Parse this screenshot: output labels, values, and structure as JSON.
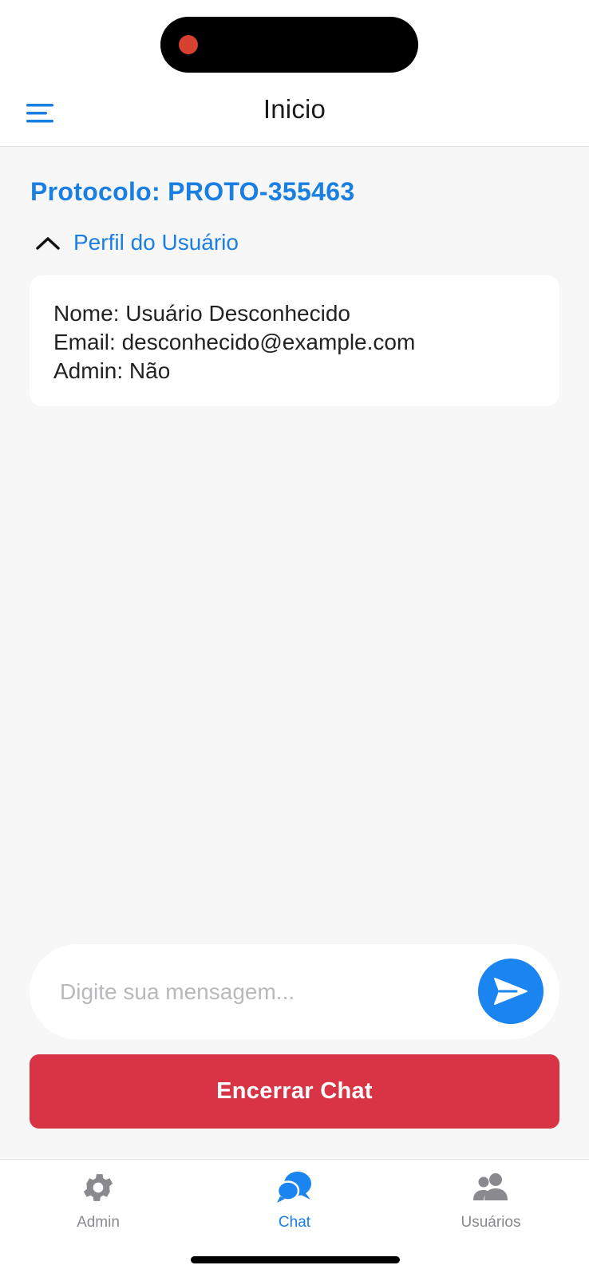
{
  "header": {
    "title": "Inicio",
    "menu_icon": "hamburger-menu-icon"
  },
  "protocol": {
    "text": "Protocolo: PROTO-355463"
  },
  "profile": {
    "toggle_label": "Perfil do Usuário",
    "toggle_icon": "chevron-up-icon",
    "name_line": "Nome: Usuário Desconhecido",
    "email_line": "Email: desconhecido@example.com",
    "admin_line": "Admin: Não"
  },
  "composer": {
    "placeholder": "Digite sua mensagem...",
    "value": "",
    "send_icon": "send-icon"
  },
  "actions": {
    "end_chat_label": "Encerrar Chat"
  },
  "tabs": [
    {
      "label": "Admin",
      "icon": "gear-icon",
      "active": false
    },
    {
      "label": "Chat",
      "icon": "chat-bubbles-icon",
      "active": true
    },
    {
      "label": "Usuários",
      "icon": "users-icon",
      "active": false
    }
  ],
  "colors": {
    "accent": "#1a7fe0",
    "send_button": "#1a84f0",
    "danger": "#d93445",
    "recording_dot": "#d7412f",
    "inactive_tab": "#8a8a8e",
    "background": "#f7f7f8"
  }
}
